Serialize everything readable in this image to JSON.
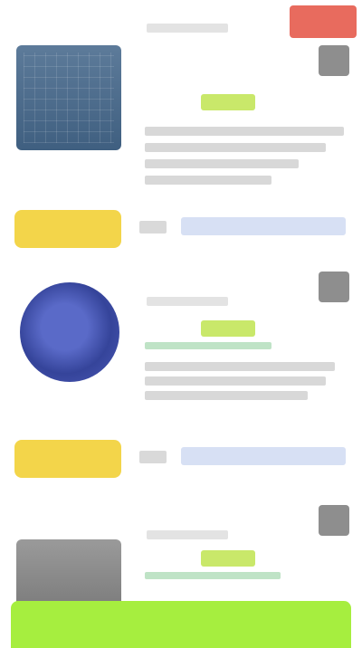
{
  "cards": [
    {
      "title": "",
      "price": "",
      "tag": "",
      "sale_badge": "",
      "button_label": "",
      "link_text": "",
      "thumb_icon": "solar-panel-icon"
    },
    {
      "title": "",
      "price": "",
      "tag": "",
      "button_label": "",
      "link_text": "",
      "thumb_icon": "fan-icon"
    },
    {
      "title": "",
      "price": "",
      "tag": "",
      "thumb_icon": "bag-icon"
    }
  ],
  "bottom_bar": {
    "left_label": "",
    "right_label": ""
  },
  "colors": {
    "buy_button": "#f3d54a",
    "bottom_bar": "#a6ee3f",
    "sale_badge": "#e86b5e",
    "tag": "#c9e86a",
    "link_bar": "#d7e0f4"
  }
}
